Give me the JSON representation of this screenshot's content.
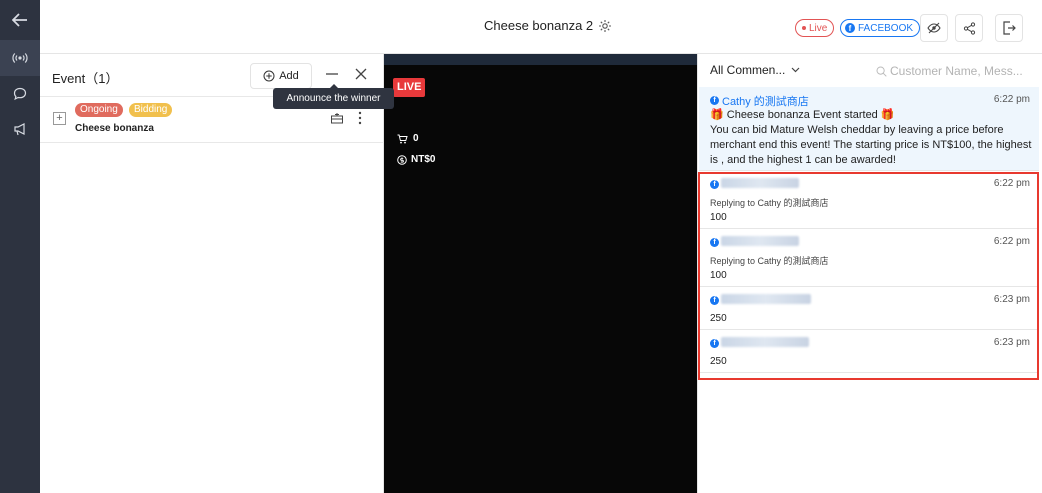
{
  "header": {
    "title": "Cheese bonanza 2",
    "live_label": "Live",
    "platform_label": "FACEBOOK"
  },
  "event_panel": {
    "title": "Event（1）",
    "add_label": "Add",
    "tooltip": "Announce the winner",
    "events": [
      {
        "tags": [
          "Ongoing",
          "Bidding"
        ],
        "name": "Cheese bonanza"
      }
    ]
  },
  "video": {
    "live_badge": "LIVE",
    "cart_count": "0",
    "amount": "NT$0"
  },
  "comments": {
    "filter_label": "All Commen...",
    "search_placeholder": "Customer Name, Mess...",
    "system": {
      "sender": "Cathy 的測試商店",
      "time": "6:22 pm",
      "line1": "🎁 Cheese bonanza Event started 🎁",
      "line2": "You can bid Mature Welsh cheddar by leaving a price before merchant end this event! The starting price is NT$100, the highest is , and the highest 1 can be awarded!"
    },
    "items": [
      {
        "time": "6:22 pm",
        "reply_to": "Replying to Cathy 的測試商店",
        "message": "100"
      },
      {
        "time": "6:22 pm",
        "reply_to": "Replying to Cathy 的測試商店",
        "message": "100"
      },
      {
        "time": "6:23 pm",
        "message": "250"
      },
      {
        "time": "6:23 pm",
        "message": "250"
      }
    ]
  },
  "colors": {
    "rail_bg": "#2d3340",
    "accent_blue": "#1877f2",
    "live_red": "#e8393b",
    "highlight_red": "#e8392f",
    "tag_ongoing": "#e06b5e",
    "tag_bidding": "#f1c04d"
  },
  "icons": [
    "back-arrow-icon",
    "broadcast-icon",
    "chat-bubble-icon",
    "megaphone-icon",
    "gear-icon",
    "eye-icon",
    "share-icon",
    "exit-icon",
    "plus-circle-icon",
    "minus-icon",
    "close-icon",
    "award-icon",
    "more-vertical-icon",
    "cart-icon",
    "coin-icon",
    "chevron-down-icon",
    "search-icon",
    "facebook-icon"
  ]
}
